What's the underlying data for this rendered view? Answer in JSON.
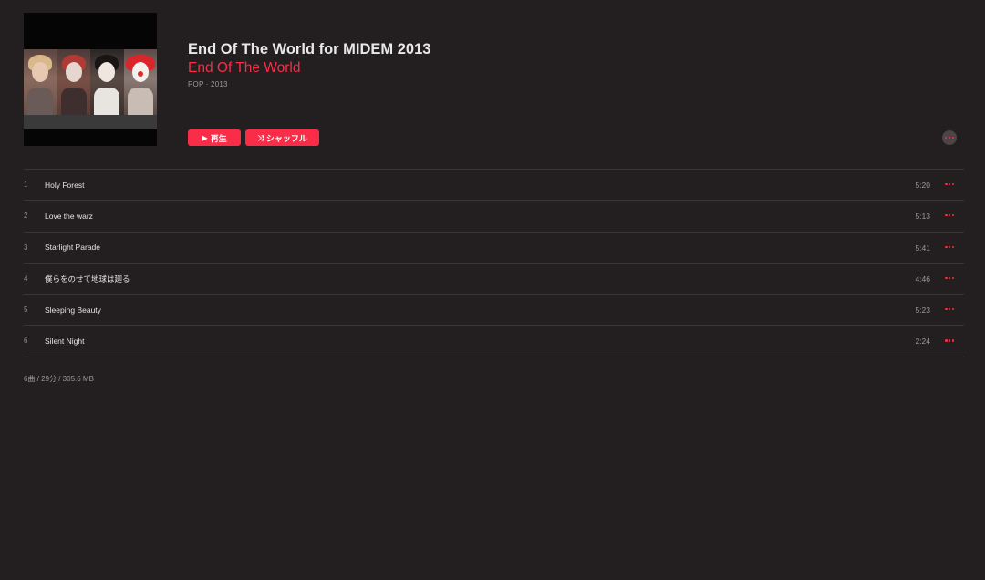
{
  "album": {
    "title": "End Of The World for MIDEM 2013",
    "artist": "End Of The World",
    "genre_year": "POP · 2013"
  },
  "actions": {
    "play_label": "再生",
    "shuffle_label": "シャッフル"
  },
  "tracks": [
    {
      "number": "1",
      "title": "Holy Forest",
      "duration": "5:20"
    },
    {
      "number": "2",
      "title": "Love the warz",
      "duration": "5:13"
    },
    {
      "number": "3",
      "title": "Starlight Parade",
      "duration": "5:41"
    },
    {
      "number": "4",
      "title": "僕らをのせて地球は廻る",
      "duration": "4:46"
    },
    {
      "number": "5",
      "title": "Sleeping Beauty",
      "duration": "5:23"
    },
    {
      "number": "6",
      "title": "Silent Night",
      "duration": "2:24"
    }
  ],
  "summary": "6曲 / 29分 / 305.6 MB",
  "colors": {
    "background": "#231f20",
    "accent": "#fa2d48"
  },
  "icons": {
    "play": "play-icon",
    "shuffle": "shuffle-icon",
    "more": "ellipsis-icon"
  }
}
